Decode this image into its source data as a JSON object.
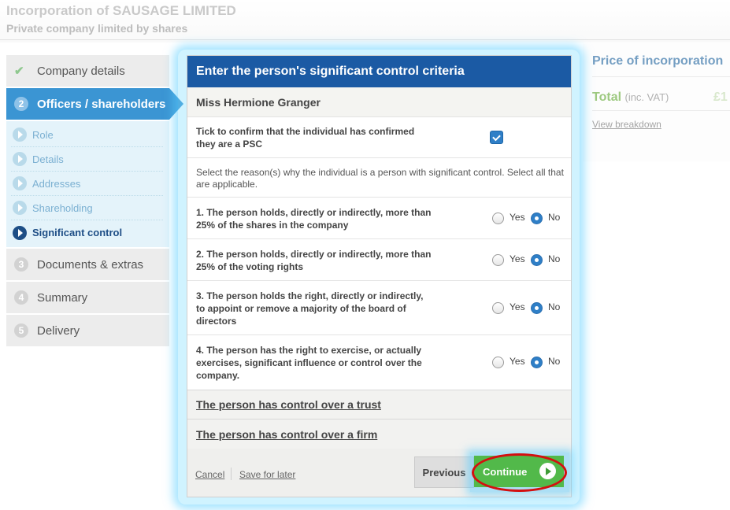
{
  "header": {
    "title": "Incorporation of SAUSAGE LIMITED",
    "subtitle": "Private company limited by shares"
  },
  "sidebar": {
    "steps": [
      {
        "num": "",
        "label": "Company details",
        "state": "done"
      },
      {
        "num": "2",
        "label": "Officers / shareholders",
        "state": "active"
      },
      {
        "num": "3",
        "label": "Documents & extras",
        "state": "todo"
      },
      {
        "num": "4",
        "label": "Summary",
        "state": "todo"
      },
      {
        "num": "5",
        "label": "Delivery",
        "state": "todo"
      }
    ],
    "substeps": [
      {
        "label": "Role"
      },
      {
        "label": "Details"
      },
      {
        "label": "Addresses"
      },
      {
        "label": "Shareholding"
      },
      {
        "label": "Significant control",
        "current": true
      }
    ]
  },
  "price": {
    "title": "Price of incorporation",
    "total_label": "Total",
    "total_note": "(inc. VAT)",
    "total_amount": "£1",
    "breakdown_link": "View breakdown"
  },
  "dialog": {
    "title": "Enter the person's significant control criteria",
    "person_name": "Miss Hermione Granger",
    "confirm_text": "Tick to confirm that the individual has confirmed they are a PSC",
    "confirm_checked": true,
    "select_note": "Select the reason(s) why the individual is a person with significant control. Select all that are applicable.",
    "yes_label": "Yes",
    "no_label": "No",
    "questions": [
      {
        "text": "1. The person holds, directly or indirectly, more than 25% of the shares in the company",
        "answer": "No"
      },
      {
        "text": "2. The person holds, directly or indirectly, more than 25% of the voting rights",
        "answer": "No"
      },
      {
        "text": "3. The person holds the right, directly or indirectly, to appoint or remove a majority of the board of directors",
        "answer": "No"
      },
      {
        "text": "4. The person has the right to exercise, or actually exercises, significant influence or control over the company.",
        "answer": "No"
      }
    ],
    "trust_link": "The person has control over a trust",
    "firm_link": "The person has control over a firm",
    "footer": {
      "cancel": "Cancel",
      "save": "Save for later",
      "previous": "Previous",
      "continue": "Continue"
    }
  },
  "colors": {
    "header_blue": "#1b5aa4",
    "active_step": "#3b95d3",
    "continue_green": "#52b94a",
    "highlight_red": "#d40f0f",
    "total_green": "#6caf3f"
  }
}
